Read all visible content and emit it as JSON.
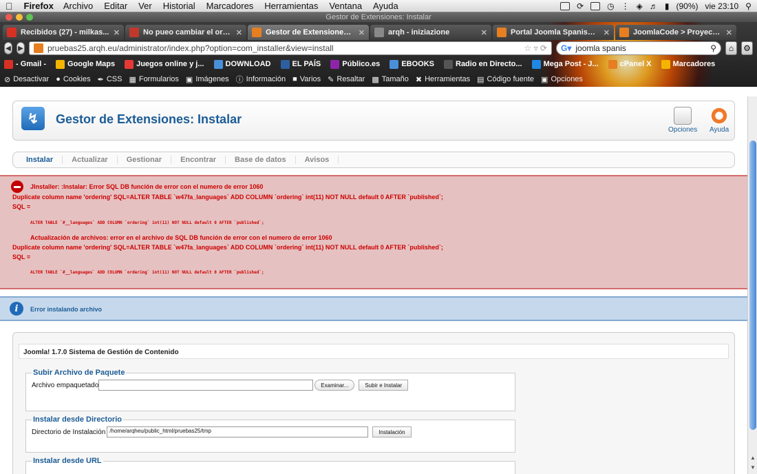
{
  "menubar": {
    "app": "Firefox",
    "items": [
      "Archivo",
      "Editar",
      "Ver",
      "Historial",
      "Marcadores",
      "Herramientas",
      "Ventana",
      "Ayuda"
    ],
    "battery": "(90%)",
    "clock": "vie 23:10"
  },
  "window_title": "Gestor de Extensiones: Instalar",
  "tabs": [
    {
      "label": "Recibidos (27) - milkas...",
      "color": "#d93025",
      "active": false
    },
    {
      "label": "No pueo cambiar el ord...",
      "color": "#c0392b",
      "active": false
    },
    {
      "label": "Gestor de Extensiones: I...",
      "color": "#e67e22",
      "active": true
    },
    {
      "label": "arqh - iniziazione",
      "color": "#888888",
      "active": false
    },
    {
      "label": "Portal Joomla Spanish -...",
      "color": "#e67e22",
      "active": false
    },
    {
      "label": "JoomlaCode > Proyecto...",
      "color": "#e67e22",
      "active": false
    }
  ],
  "nav": {
    "url": "pruebas25.arqh.eu/administrator/index.php?option=com_installer&view=install",
    "search_value": "joomla spanis"
  },
  "bookmarks": [
    {
      "label": "- Gmail -",
      "color": "#d93025"
    },
    {
      "label": "Google Maps",
      "color": "#f4b400"
    },
    {
      "label": "Juegos online y j...",
      "color": "#e53935"
    },
    {
      "label": "DOWNLOAD",
      "color": "#4a90d9"
    },
    {
      "label": "EL PAÍS",
      "color": "#2d5fa0"
    },
    {
      "label": "Público.es",
      "color": "#8e24aa"
    },
    {
      "label": "EBOOKS",
      "color": "#4a90d9"
    },
    {
      "label": "Radio en Directo...",
      "color": "#555555"
    },
    {
      "label": "Mega Post - J...",
      "color": "#1e88e5"
    },
    {
      "label": "cPanel X",
      "color": "#e67e22"
    },
    {
      "label": "Marcadores",
      "color": "#f4b400"
    }
  ],
  "webdev_toolbar": [
    "Desactivar",
    "Cookies",
    "CSS",
    "Formularios",
    "Imágenes",
    "Información",
    "Varios",
    "Resaltar",
    "Tamaño",
    "Herramientas",
    "Código fuente",
    "Opciones"
  ],
  "page": {
    "title": "Gestor de Extensiones: Instalar",
    "options_label": "Opciones",
    "help_label": "Ayuda",
    "submenu": [
      "Instalar",
      "Actualizar",
      "Gestionar",
      "Encontrar",
      "Base de datos",
      "Avisos"
    ],
    "error": {
      "line1": "JInstaller: :Instalar: Error SQL DB función de error con el numero de error 1060",
      "line2": "Duplicate column name 'ordering' SQL=ALTER TABLE `w47fa_languages` ADD COLUMN `ordering` int(11) NOT NULL default 0 AFTER `published`;",
      "line3": "SQL =",
      "code1": "ALTER TABLE `#__languages` ADD COLUMN `ordering` int(11) NOT NULL default 0 AFTER `published`;",
      "line4": "Actualización de archivos: error en el archivo de SQL DB función de error con el numero de error 1060",
      "line5": "Duplicate column name 'ordering' SQL=ALTER TABLE `w47fa_languages` ADD COLUMN `ordering` int(11) NOT NULL default 0 AFTER `published`;",
      "line6": "SQL =",
      "code2": "ALTER TABLE `#__languages` ADD COLUMN `ordering` int(11) NOT NULL default 0 AFTER `published`;"
    },
    "message": "Error instalando archivo",
    "version": "Joomla! 1.7.0 Sistema de Gestión de Contenido",
    "upload": {
      "legend": "Subir Archivo de Paquete",
      "label": "Archivo empaquetado",
      "browse": "Examinar...",
      "submit": "Subir e Instalar"
    },
    "directory": {
      "legend": "Instalar desde Directorio",
      "label": "Directorio de Instalación",
      "value": "/home/arqheu/public_html/pruebas25/tmp",
      "submit": "Instalación"
    },
    "url": {
      "legend": "Instalar desde URL"
    }
  }
}
